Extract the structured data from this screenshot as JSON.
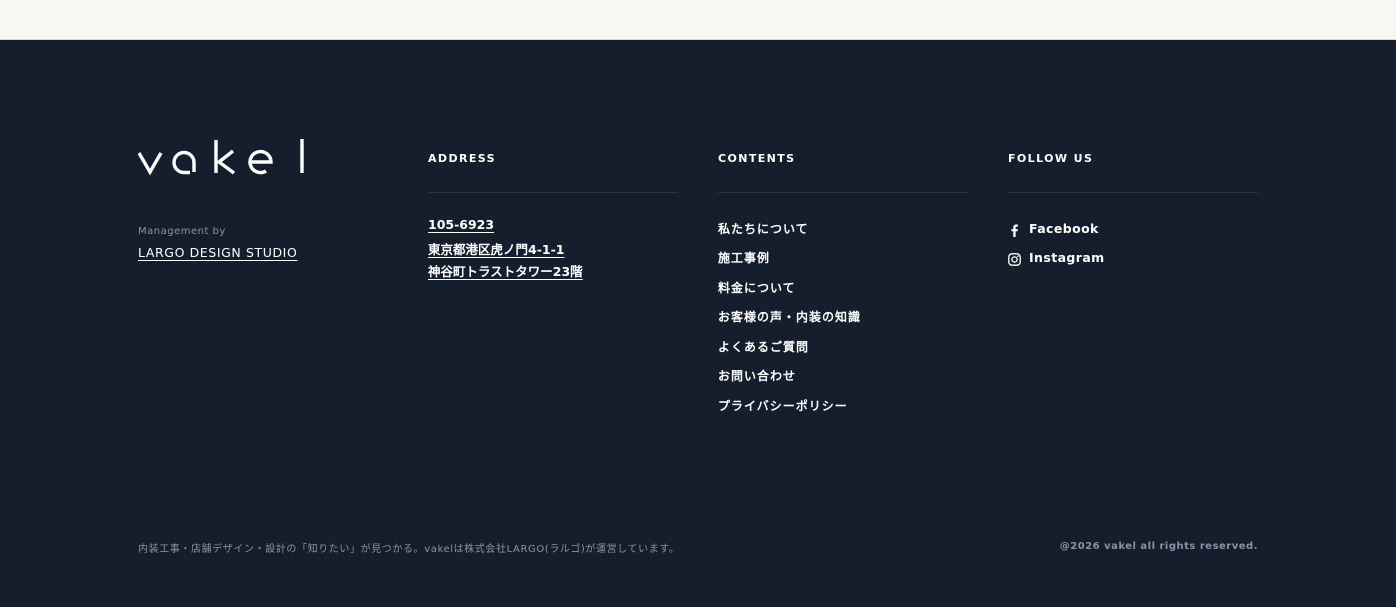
{
  "brand": {
    "logo_text": "vakel",
    "management_label": "Management by",
    "management_company": "LARGO DESIGN STUDIO"
  },
  "address": {
    "heading": "ADDRESS",
    "lines": [
      "105-6923",
      "東京都港区虎ノ門4-1-1",
      "神谷町トラストタワー23階"
    ]
  },
  "contents": {
    "heading": "CONTENTS",
    "items": [
      "私たちについて",
      "施工事例",
      "料金について",
      "お客様の声・内装の知識",
      "よくあるご質問",
      "お問い合わせ",
      "プライバシーポリシー"
    ]
  },
  "follow": {
    "heading": "FOLLOW US",
    "items": [
      {
        "label": "Facebook",
        "icon": "facebook-icon"
      },
      {
        "label": "Instagram",
        "icon": "instagram-icon"
      }
    ]
  },
  "bottom": {
    "tagline": "内装工事・店舗デザイン・設計の「知りたい」が見つかる。vakelは株式会社LARGO(ラルゴ)が運営しています。",
    "copyright": "@2026 vakel all rights reserved."
  },
  "colors": {
    "footer_bg": "#151e2c",
    "top_bg": "#f8f7f3",
    "muted_text": "#8a93a3",
    "divider": "#2a3443"
  }
}
